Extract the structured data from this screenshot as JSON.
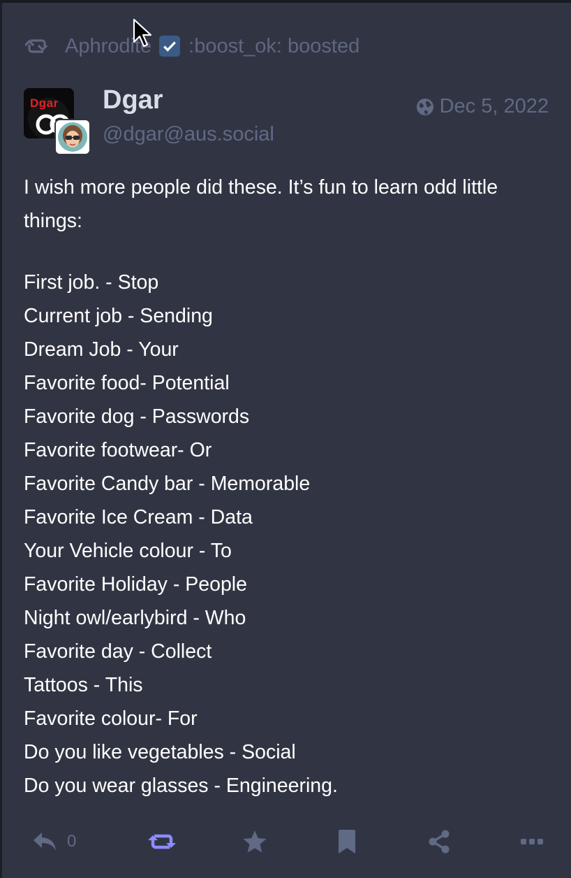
{
  "boost": {
    "booster_name": "Aphrodite",
    "action_text": ":boost_ok: boosted"
  },
  "post": {
    "display_name": "Dgar",
    "handle": "@dgar@aus.social",
    "avatar_text": "Dgar",
    "timestamp": "Dec 5, 2022",
    "intro": "I wish more people did these. It’s fun to learn odd little things:",
    "lines": [
      "First job. - Stop",
      "Current job - Sending",
      "Dream Job - Your",
      "Favorite food- Potential",
      "Favorite dog - Passwords",
      "Favorite footwear- Or",
      "Favorite Candy bar - Memorable",
      "Favorite Ice Cream - Data",
      "Your Vehicle colour - To",
      "Favorite Holiday - People",
      "Night owl/earlybird - Who",
      "Favorite day - Collect",
      "Tattoos - This",
      "Favorite colour- For",
      "Do you like vegetables - Social",
      "Do you wear glasses - Engineering."
    ]
  },
  "actions": {
    "reply_count": "0",
    "boost_active_color": "#8c8dff",
    "icon_color": "#606a85",
    "icons": [
      "reply-icon",
      "boost-icon",
      "favourite-icon",
      "bookmark-icon",
      "share-icon",
      "more-icon"
    ]
  },
  "colors": {
    "background": "#313543",
    "muted_text": "#606a85",
    "body_text": "#ffffff",
    "accent": "#8c8dff"
  }
}
